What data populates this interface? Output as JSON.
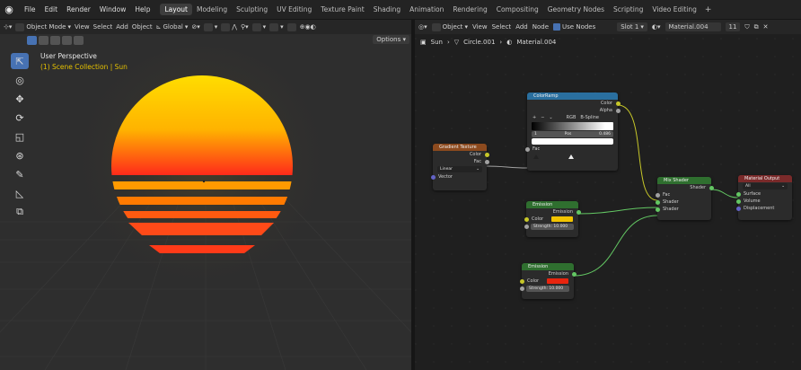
{
  "topbar": {
    "menus": [
      "File",
      "Edit",
      "Render",
      "Window",
      "Help"
    ],
    "workspaces": [
      "Layout",
      "Modeling",
      "Sculpting",
      "UV Editing",
      "Texture Paint",
      "Shading",
      "Animation",
      "Rendering",
      "Compositing",
      "Geometry Nodes",
      "Scripting",
      "Video Editing"
    ],
    "active_workspace": "Layout",
    "add_tab": "+"
  },
  "viewport": {
    "mode": "Object Mode",
    "menus": [
      "View",
      "Select",
      "Add",
      "Object"
    ],
    "orientation": "Global",
    "options": "Options",
    "label_view": "User Perspective",
    "label_collection": "(1) Scene Collection | Sun",
    "colors": {
      "sun_top": "#ffd400",
      "sun_bottom": "#ff2a1a",
      "label_collection": "#e5c000"
    }
  },
  "node_editor": {
    "object_mode": "Object",
    "menus": [
      "View",
      "Select",
      "Add",
      "Node"
    ],
    "use_nodes_label": "Use Nodes",
    "slot": "Slot 1",
    "material": "Material.004",
    "user_count": "11",
    "breadcrumb": [
      "Sun",
      "Circle.001",
      "Material.004"
    ]
  },
  "nodes": {
    "colorramp": {
      "title": "ColorRamp",
      "out_color": "Color",
      "out_alpha": "Alpha",
      "color_mode": "RGB",
      "interpolation": "B-Spline",
      "stop_index": "1",
      "pos_label": "Pos",
      "pos_value": "0.486",
      "in_fac": "Fac"
    },
    "gradient": {
      "title": "Gradient Texture",
      "out_color": "Color",
      "out_fac": "Fac",
      "type": "Linear",
      "in_vector": "Vector"
    },
    "emission1": {
      "title": "Emission",
      "out": "Emission",
      "color_label": "Color",
      "strength": "Strength: 10.000",
      "color": "#f2c400"
    },
    "emission2": {
      "title": "Emission",
      "out": "Emission",
      "color_label": "Color",
      "strength": "Strength: 10.000",
      "color": "#e8240e"
    },
    "mix": {
      "title": "Mix Shader",
      "out": "Shader",
      "in_fac": "Fac",
      "in_shader1": "Shader",
      "in_shader2": "Shader"
    },
    "output": {
      "title": "Material Output",
      "target": "All",
      "in_surface": "Surface",
      "in_volume": "Volume",
      "in_displacement": "Displacement"
    }
  }
}
